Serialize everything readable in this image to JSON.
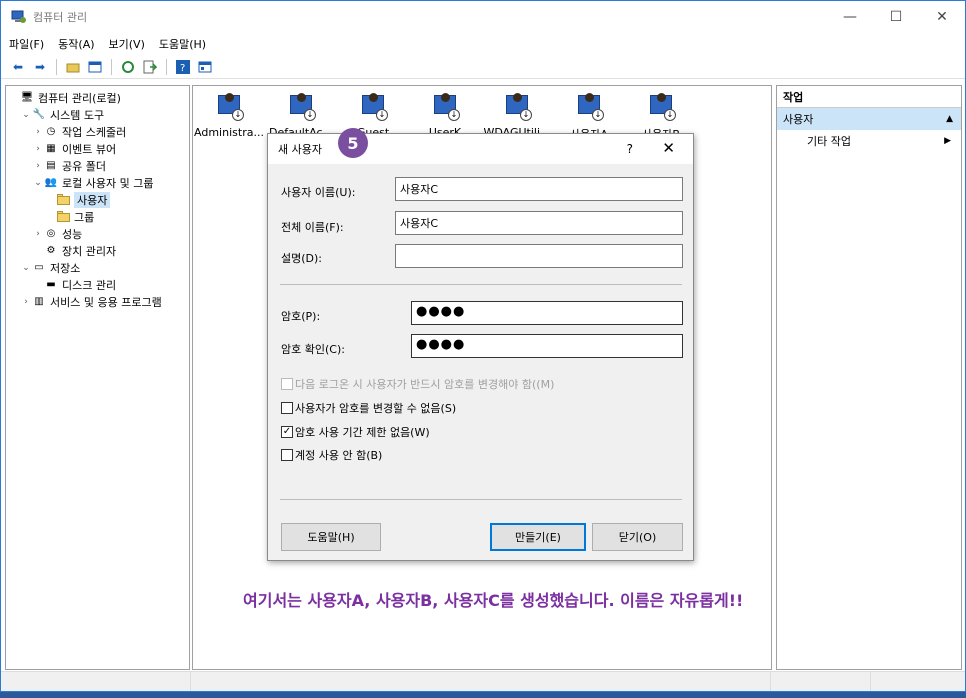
{
  "window": {
    "title": "컴퓨터 관리",
    "minimize": "—",
    "maximize": "☐",
    "close": "✕"
  },
  "menu": [
    "파일(F)",
    "동작(A)",
    "보기(V)",
    "도움말(H)"
  ],
  "tree": [
    {
      "label": "컴퓨터 관리(로컬)",
      "indent": 0,
      "exp": "",
      "icon": "computer-icon",
      "selected": false
    },
    {
      "label": "시스템 도구",
      "indent": 1,
      "exp": "⌄",
      "icon": "tools-icon",
      "selected": false
    },
    {
      "label": "작업 스케줄러",
      "indent": 2,
      "exp": "›",
      "icon": "clock-icon",
      "selected": false
    },
    {
      "label": "이벤트 뷰어",
      "indent": 2,
      "exp": "›",
      "icon": "event-icon",
      "selected": false
    },
    {
      "label": "공유 폴더",
      "indent": 2,
      "exp": "›",
      "icon": "share-icon",
      "selected": false
    },
    {
      "label": "로컬 사용자 및 그룹",
      "indent": 2,
      "exp": "⌄",
      "icon": "users-icon",
      "selected": false
    },
    {
      "label": "사용자",
      "indent": 3,
      "exp": "",
      "icon": "folder-icon",
      "selected": true
    },
    {
      "label": "그룹",
      "indent": 3,
      "exp": "",
      "icon": "folder-icon",
      "selected": false
    },
    {
      "label": "성능",
      "indent": 2,
      "exp": "›",
      "icon": "performance-icon",
      "selected": false
    },
    {
      "label": "장치 관리자",
      "indent": 2,
      "exp": "",
      "icon": "device-icon",
      "selected": false
    },
    {
      "label": "저장소",
      "indent": 1,
      "exp": "⌄",
      "icon": "storage-icon",
      "selected": false
    },
    {
      "label": "디스크 관리",
      "indent": 2,
      "exp": "",
      "icon": "disk-icon",
      "selected": false
    },
    {
      "label": "서비스 및 응용 프로그램",
      "indent": 1,
      "exp": "›",
      "icon": "services-icon",
      "selected": false
    }
  ],
  "users": [
    "Administra...",
    "DefaultAc...",
    "Guest",
    "UserK",
    "WDAGUtili...",
    "사용자A",
    "사용자B"
  ],
  "actions": {
    "header": "작업",
    "section": "사용자",
    "section_arrow": "▲",
    "item": "기타 작업",
    "item_arrow": "▶"
  },
  "dialog": {
    "title": "새 사용자",
    "help": "?",
    "close": "✕",
    "step": "5",
    "username_label": "사용자 이름(U):",
    "username_value": "사용자C",
    "fullname_label": "전체 이름(F):",
    "fullname_value": "사용자C",
    "description_label": "설명(D):",
    "description_value": "",
    "password_label": "암호(P):",
    "password_value": "●●●●",
    "confirm_label": "암호 확인(C):",
    "confirm_value": "●●●●",
    "cb_must_change": "다음 로그온 시 사용자가 반드시 암호를 변경해야 함((M)",
    "cb_cannot_change": "사용자가 암호를 변경할 수 없음(S)",
    "cb_never_expires": "암호 사용 기간 제한 없음(W)",
    "cb_disabled": "계정 사용 안 함(B)",
    "cb_check_mark": "✓",
    "help_button": "도움말(H)",
    "create_button": "만들기(E)",
    "close_button": "닫기(O)"
  },
  "caption": "여기서는 사용자A, 사용자B, 사용자C를 생성했습니다. 이름은 자유롭게!!"
}
